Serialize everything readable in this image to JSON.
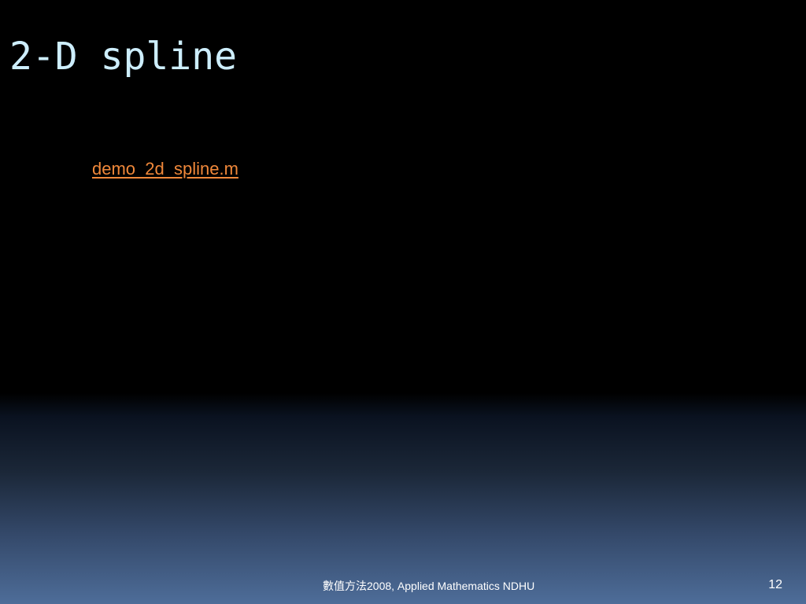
{
  "slide": {
    "title": "2-D spline",
    "link_label": "demo_2d_spline.m",
    "footer": "數值方法2008, Applied Mathematics  NDHU",
    "slide_number": "12"
  },
  "colors": {
    "title": "#cdeefd",
    "link": "#f0883a",
    "footer_text": "#ffffff"
  }
}
